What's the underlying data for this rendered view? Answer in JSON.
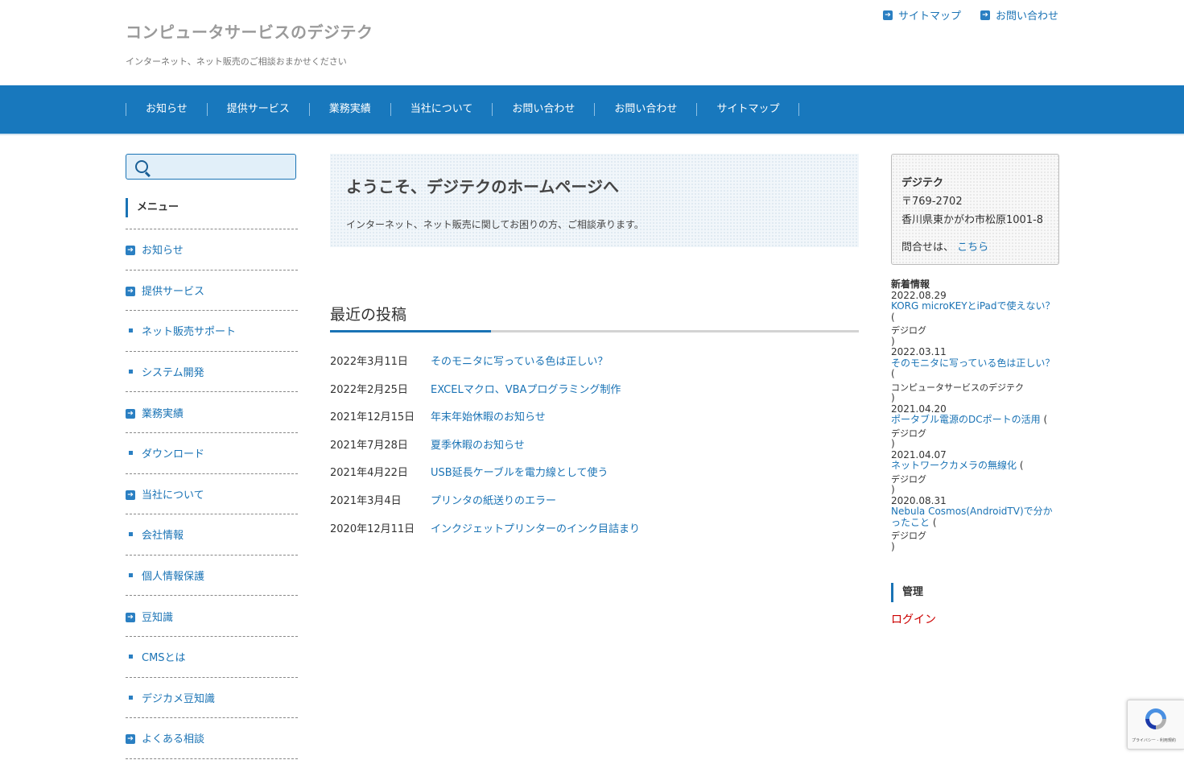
{
  "header": {
    "site_title": "コンピュータサービスのデジテク",
    "site_description": "インターネット、ネット販売のご相談おまかせください",
    "top_links": [
      "サイトマップ",
      "お問い合わせ"
    ]
  },
  "nav": {
    "items": [
      "お知らせ",
      "提供サービス",
      "業務実績",
      "当社について",
      "お問い合わせ",
      "お問い合わせ",
      "サイトマップ"
    ]
  },
  "search": {
    "placeholder": ""
  },
  "sidebar": {
    "heading": "メニュー",
    "items": [
      {
        "label": "お知らせ",
        "icon": "arrow"
      },
      {
        "label": "提供サービス",
        "icon": "arrow"
      },
      {
        "label": "ネット販売サポート",
        "icon": "square"
      },
      {
        "label": "システム開発",
        "icon": "square"
      },
      {
        "label": "業務実績",
        "icon": "arrow"
      },
      {
        "label": "ダウンロード",
        "icon": "square"
      },
      {
        "label": "当社について",
        "icon": "arrow"
      },
      {
        "label": "会社情報",
        "icon": "square"
      },
      {
        "label": "個人情報保護",
        "icon": "square"
      },
      {
        "label": "豆知識",
        "icon": "arrow"
      },
      {
        "label": "CMSとは",
        "icon": "square"
      },
      {
        "label": "デジカメ豆知識",
        "icon": "square"
      },
      {
        "label": "よくある相談",
        "icon": "arrow"
      }
    ]
  },
  "welcome": {
    "heading": "ようこそ、デジテクのホームページへ",
    "text": "インターネット、ネット販売に関してお困りの方、ご相談承ります。"
  },
  "recent_posts": {
    "heading": "最近の投稿",
    "posts": [
      {
        "date": "2022年3月11日",
        "title": "そのモニタに写っている色は正しい？"
      },
      {
        "date": "2022年2月25日",
        "title": "EXCELマクロ、VBAプログラミング制作"
      },
      {
        "date": "2021年12月15日",
        "title": "年末年始休暇のお知らせ"
      },
      {
        "date": "2021年7月28日",
        "title": "夏季休暇のお知らせ"
      },
      {
        "date": "2021年4月22日",
        "title": "USB延長ケーブルを電力線として使う"
      },
      {
        "date": "2021年3月4日",
        "title": "プリンタの紙送りのエラー"
      },
      {
        "date": "2020年12月11日",
        "title": "インクジェットプリンターのインク目詰まり"
      }
    ]
  },
  "company": {
    "name": "デジテク",
    "zip": "〒769-2702",
    "address": "香川県東かがわ市松原1001-8",
    "contact_label": "問合せは、",
    "contact_link": "こちら"
  },
  "news": {
    "heading": "新着情報",
    "items": [
      {
        "date": "2022.08.29",
        "title": "KORG microKEYとiPadで使えない？",
        "source": "デジログ"
      },
      {
        "date": "2022.03.11",
        "title": "そのモニタに写っている色は正しい？",
        "source": "コンピュータサービスのデジテク"
      },
      {
        "date": "2021.04.20",
        "title": "ポータブル電源のDCポートの活用",
        "source": "デジログ"
      },
      {
        "date": "2021.04.07",
        "title": "ネットワークカメラの無線化",
        "source": "デジログ"
      },
      {
        "date": "2020.08.31",
        "title": "Nebula Cosmos(AndroidTV)で分かったこと",
        "source": "デジログ"
      }
    ]
  },
  "admin": {
    "heading": "管理",
    "login": "ログイン"
  },
  "recaptcha": {
    "text": "プライバシー - 利用規約"
  },
  "colors": {
    "brand": "#1878bd",
    "link": "#1a73b5",
    "login": "#cc0000"
  }
}
